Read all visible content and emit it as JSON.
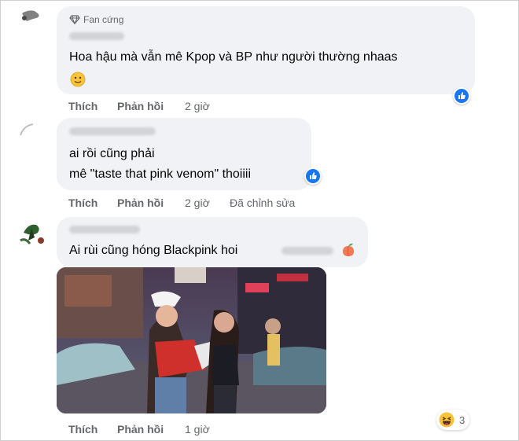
{
  "colors": {
    "bubble": "#f0f2f5",
    "secondary_text": "#65676b",
    "like_blue": "#1877f2",
    "haha_yellow": "#f7c33a"
  },
  "comments": [
    {
      "badge": "Fan cứng",
      "text_lines": [
        "Hoa hậu mà vẫn mê Kpop và BP như người thường nhaas"
      ],
      "emoji_icon": "slight-smile-emoji",
      "reaction_icon": "like-icon",
      "actions": {
        "like": "Thích",
        "reply": "Phản hồi",
        "time": "2 giờ"
      }
    },
    {
      "text_lines": [
        "ai rồi cũng phải",
        "mê \"taste that pink venom\" thoiiii"
      ],
      "reaction_icon": "like-icon",
      "actions": {
        "like": "Thích",
        "reply": "Phản hồi",
        "time": "2 giờ",
        "edited": "Đã chỉnh sửa"
      }
    },
    {
      "text_lines": [
        "Ai rùi cũng hóng Blackpink hoi"
      ],
      "emoji_icon": "peach-emoji",
      "gif_description_icon": "animated-gif-image",
      "reaction_icon": "haha-icon",
      "reaction_count": "3",
      "actions": {
        "like": "Thích",
        "reply": "Phản hồi",
        "time": "1 giờ"
      }
    }
  ]
}
